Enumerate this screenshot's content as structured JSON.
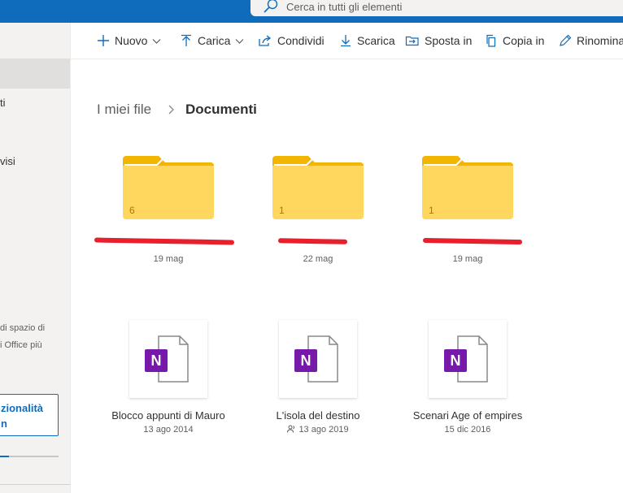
{
  "search": {
    "placeholder": "Cerca in tutti gli elementi",
    "icon": "search-icon"
  },
  "sidebar": {
    "items": [
      {
        "label": "ti"
      },
      {
        "label": "visi"
      }
    ],
    "storage_note": [
      "di spazio di",
      "i Office più"
    ],
    "upgrade_button": [
      "zionalità",
      "n"
    ],
    "storage_used_fraction": 0.15
  },
  "toolbar": {
    "new": "Nuovo",
    "upload": "Carica",
    "share": "Condividi",
    "download": "Scarica",
    "move": "Sposta in",
    "copy": "Copia in",
    "rename": "Rinomina"
  },
  "breadcrumb": {
    "root": "I miei file",
    "current": "Documenti"
  },
  "folders": [
    {
      "count": "6",
      "date": "19 mag"
    },
    {
      "count": "1",
      "date": "22 mag"
    },
    {
      "count": "1",
      "date": "19 mag"
    }
  ],
  "notebooks": [
    {
      "name": "Blocco appunti di Mauro",
      "date": "13 ago 2014",
      "shared": false
    },
    {
      "name": "L'isola del destino",
      "date": "13 ago 2019",
      "shared": true
    },
    {
      "name": "Scenari Age of empires",
      "date": "15 dic 2016",
      "shared": false
    }
  ],
  "colors": {
    "accent": "#0f6cbd",
    "folder": "#ffd75e",
    "onenote": "#7719aa",
    "redaction": "#e8202c"
  }
}
